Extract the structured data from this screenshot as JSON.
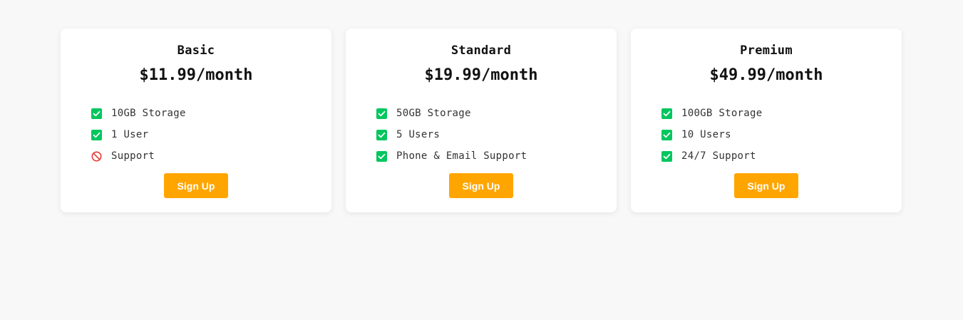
{
  "plans": [
    {
      "name": "Basic",
      "price": "$11.99/month",
      "features": [
        {
          "text": "10GB Storage",
          "icon": "check-icon",
          "included": true
        },
        {
          "text": "1 User",
          "icon": "check-icon",
          "included": true
        },
        {
          "text": "Support",
          "icon": "ban-icon",
          "included": false
        }
      ],
      "button_label": "Sign Up"
    },
    {
      "name": "Standard",
      "price": "$19.99/month",
      "features": [
        {
          "text": "50GB Storage",
          "icon": "check-icon",
          "included": true
        },
        {
          "text": "5 Users",
          "icon": "check-icon",
          "included": true
        },
        {
          "text": "Phone & Email Support",
          "icon": "check-icon",
          "included": true
        }
      ],
      "button_label": "Sign Up"
    },
    {
      "name": "Premium",
      "price": "$49.99/month",
      "features": [
        {
          "text": "100GB Storage",
          "icon": "check-icon",
          "included": true
        },
        {
          "text": "10 Users",
          "icon": "check-icon",
          "included": true
        },
        {
          "text": "24/7 Support",
          "icon": "check-icon",
          "included": true
        }
      ],
      "button_label": "Sign Up"
    }
  ],
  "colors": {
    "background": "#f8f8f8",
    "card": "#ffffff",
    "check": "#00c65e",
    "ban": "#e53935",
    "button": "#ffa500",
    "button_text": "#ffffff"
  }
}
